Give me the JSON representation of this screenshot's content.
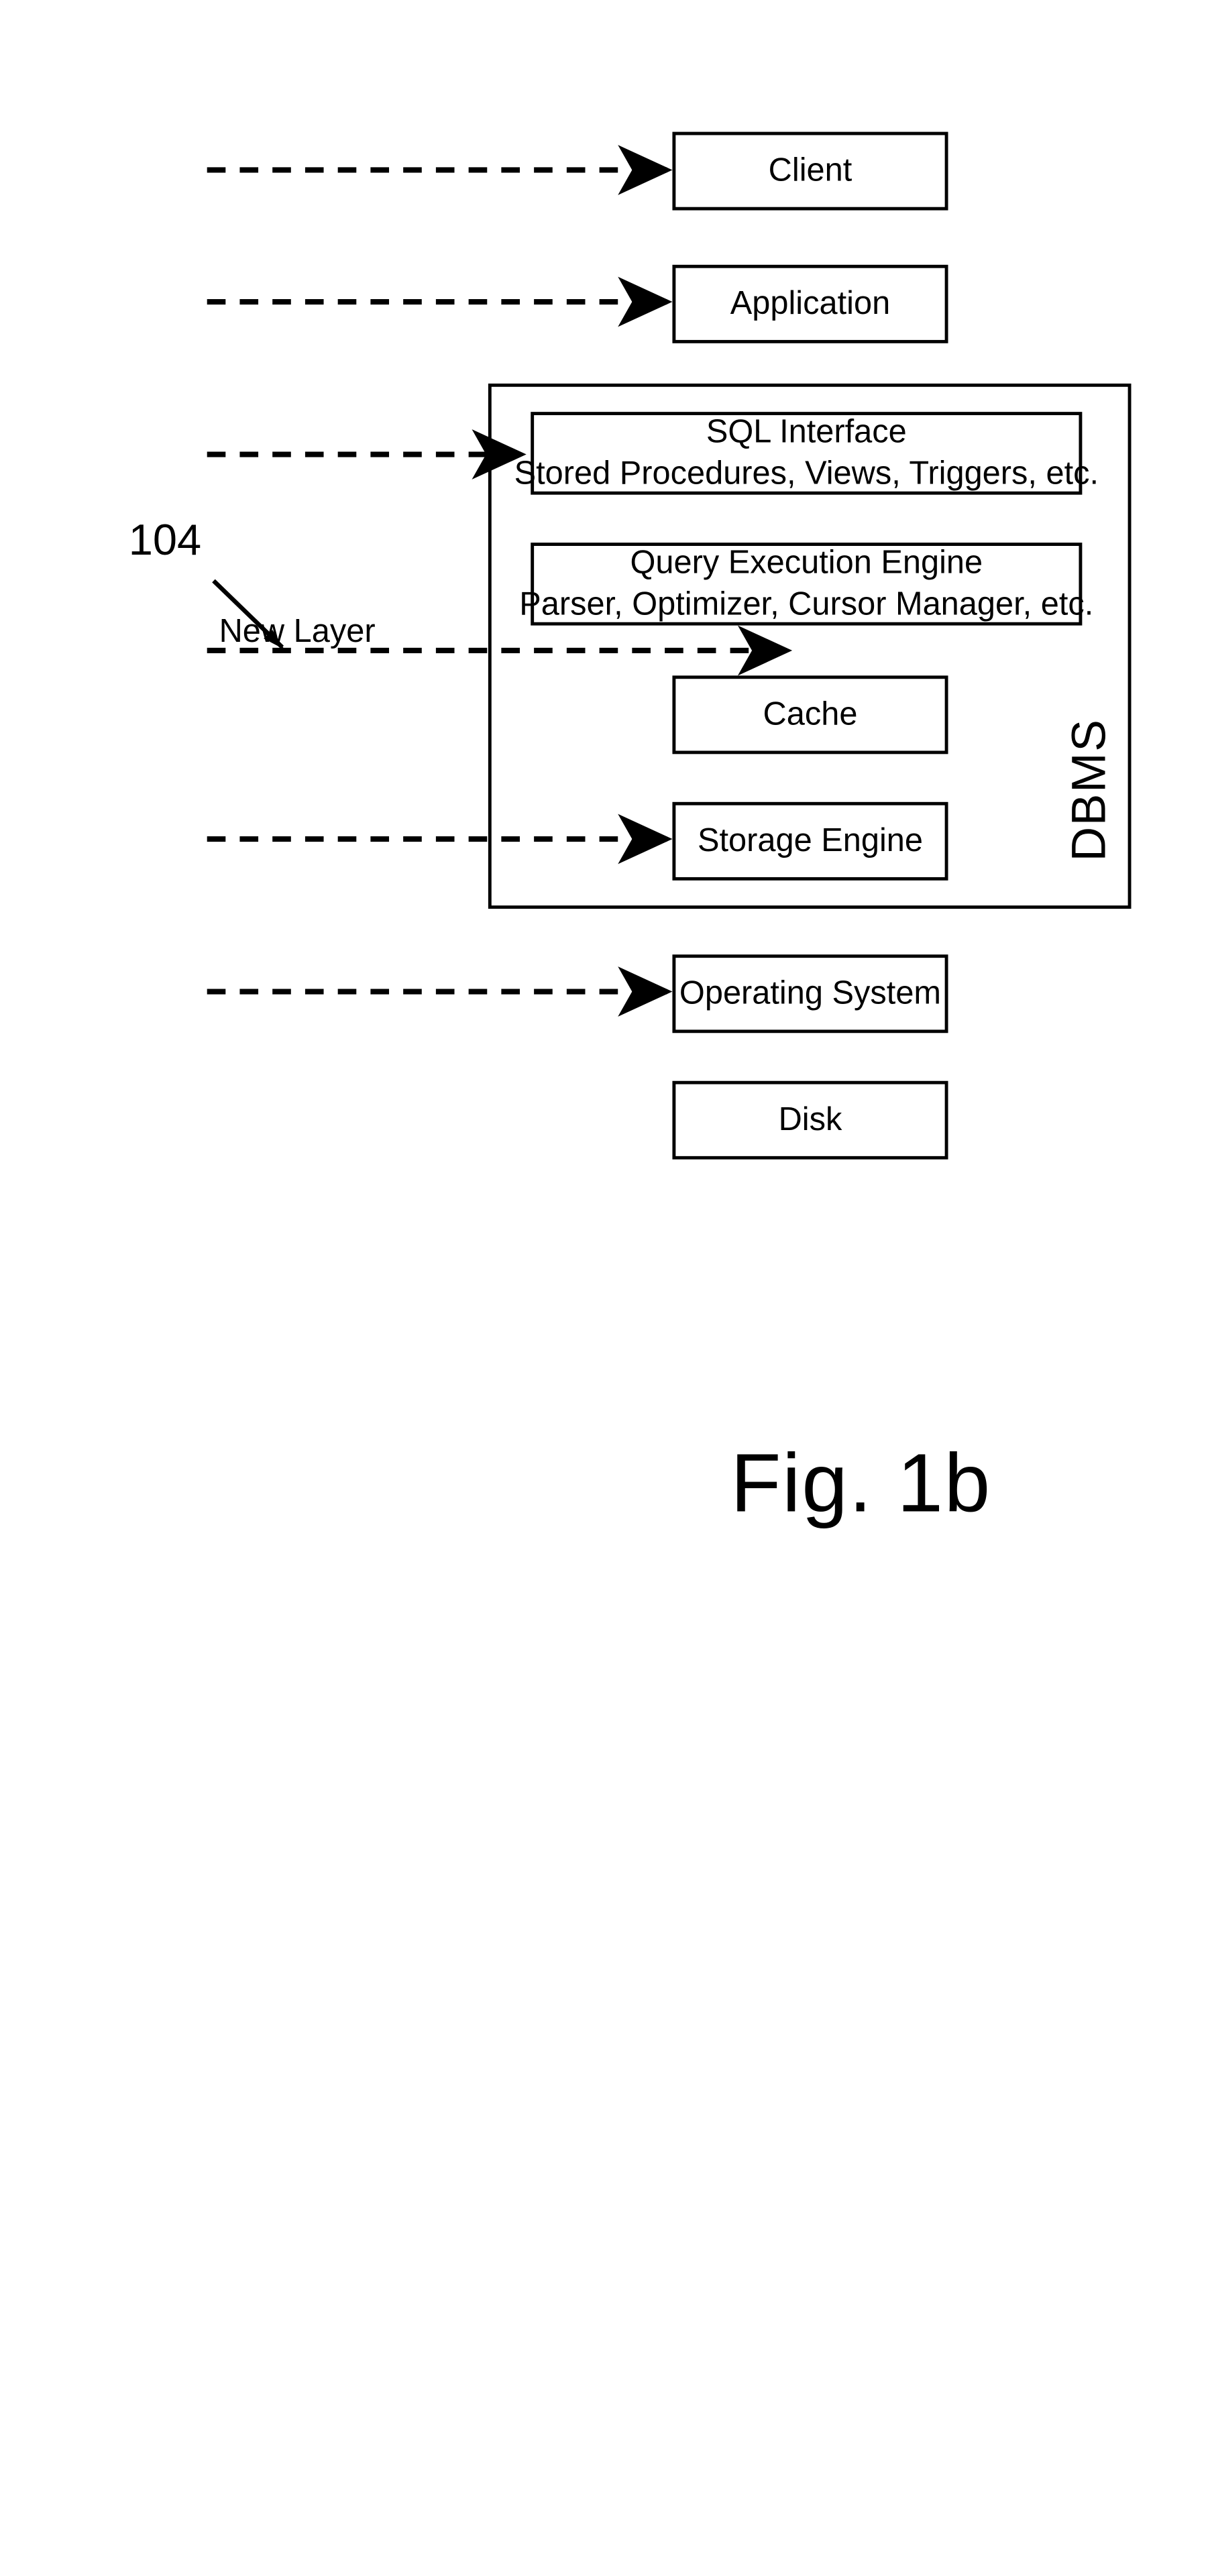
{
  "figure": {
    "caption": "Fig. 1b",
    "reference_number": "104",
    "new_layer_label": "New Layer",
    "container_label": "DBMS",
    "line_color": "#000000",
    "background_color": "#ffffff"
  },
  "nodes": {
    "client": {
      "title": "Client"
    },
    "application": {
      "title": "Application"
    },
    "sql_interface": {
      "title": "SQL Interface",
      "subtitle": "Stored Procedures, Views, Triggers, etc."
    },
    "query_execution_engine": {
      "title": "Query Execution Engine",
      "subtitle": "Parser, Optimizer, Cursor Manager, etc."
    },
    "cache": {
      "title": "Cache"
    },
    "storage_engine": {
      "title": "Storage Engine"
    },
    "operating_system": {
      "title": "Operating System"
    },
    "disk": {
      "title": "Disk"
    }
  },
  "connectors": {
    "client_application": "bidirectional-arrow",
    "application_sql_interface": "bidirectional-arrow",
    "sql_query_engine": "bidirectional-arrow",
    "query_engine_cache": "bidirectional-arrow",
    "cache_storage_engine": "bidirectional-arrow",
    "storage_engine_operating_system": "bidirectional-arrow",
    "operating_system_disk": "bidirectional-arrow"
  },
  "dashed_inputs": [
    {
      "target": "client"
    },
    {
      "target": "application"
    },
    {
      "target": "sql_interface"
    },
    {
      "target": "new_layer"
    },
    {
      "target": "storage_engine"
    },
    {
      "target": "operating_system"
    }
  ]
}
